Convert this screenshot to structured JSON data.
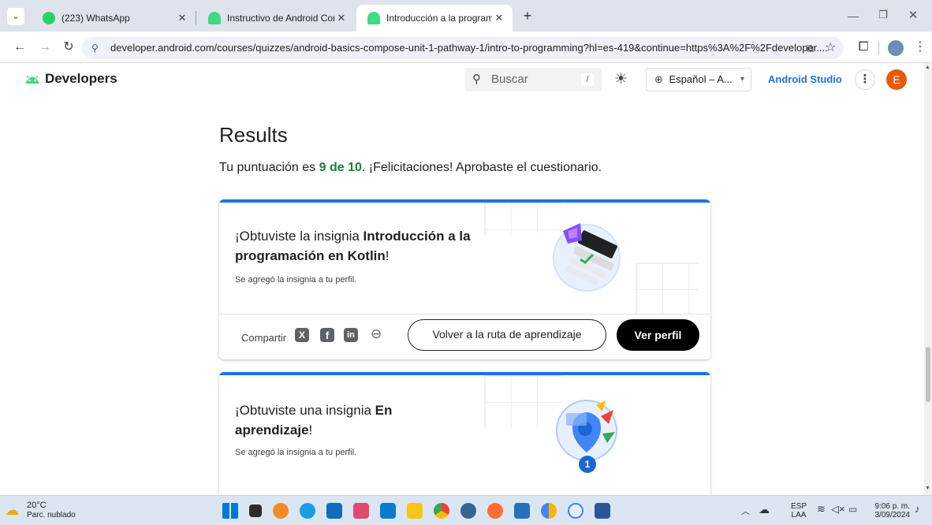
{
  "browser": {
    "tabs": [
      {
        "label": "(223) WhatsApp",
        "favicon_color": "#25d366"
      },
      {
        "label": "Instructivo de Android Compos",
        "favicon_color": "#3ddc84"
      },
      {
        "label": "Introducción a la programación",
        "favicon_color": "#3ddc84",
        "active": true
      }
    ],
    "new_tab": "+",
    "url": "developer.android.com/courses/quizzes/android-basics-compose-unit-1-pathway-1/intro-to-programming?hl=es-419&continue=https%3A%2F%2Fdeveloper...."
  },
  "site_header": {
    "brand": "Developers",
    "search_placeholder": "Buscar",
    "search_shortcut": "/",
    "language": "Español – A...",
    "android_studio": "Android Studio",
    "avatar_letter": "E"
  },
  "results": {
    "heading": "Results",
    "score_prefix": "Tu puntuación es ",
    "score_value": "9 de 10",
    "score_suffix": ". ¡Felicitaciones! Aprobaste el cuestionario."
  },
  "badge1": {
    "title_pre": "¡Obtuviste la insignia ",
    "title_bold": "Introducción a la programación en Kotlin",
    "title_post": "!",
    "subtitle": "Se agregó la insignia a tu perfil.",
    "share_label": "Compartir",
    "path_button": "Volver a la ruta de aprendizaje",
    "profile_button": "Ver perfil"
  },
  "badge2": {
    "title_pre": "¡Obtuviste una insignia ",
    "title_bold": "En aprendizaje",
    "title_post": "!",
    "subtitle": "Se agregó la insignia a tu perfil.",
    "badge_count": "1"
  },
  "taskbar": {
    "weather_temp": "20°C",
    "weather_desc": "Parc. nublado",
    "lang_top": "ESP",
    "lang_bottom": "LAA",
    "time": "9:06 p. m.",
    "date": "3/09/2024"
  },
  "colors": {
    "accent_blue": "#1a73e8",
    "score_green": "#188038",
    "android_green": "#3ddc84",
    "avatar_orange": "#e8590c"
  }
}
